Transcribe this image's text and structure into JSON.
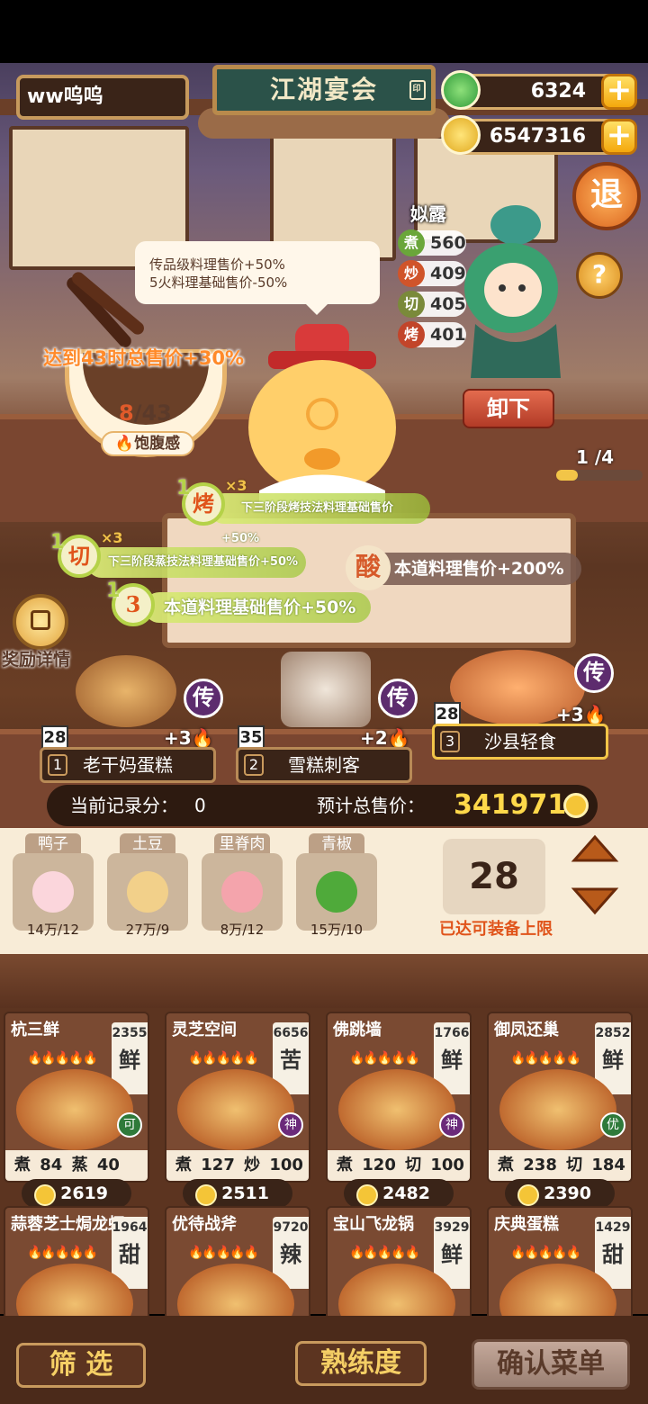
{
  "header": {
    "username": "ww呜呜",
    "title": "江湖宴会",
    "jade": "6324",
    "coins": "6547316",
    "exit_label": "退",
    "help_label": "?"
  },
  "chef": {
    "name": "姒露",
    "stats": [
      {
        "icon": "煮",
        "value": "560",
        "color": "#6aa63a"
      },
      {
        "icon": "炒",
        "value": "409",
        "color": "#d0542a"
      },
      {
        "icon": "切",
        "value": "405",
        "color": "#7a8a3a"
      },
      {
        "icon": "烤",
        "value": "401",
        "color": "#c2452a"
      }
    ],
    "unload_label": "卸下",
    "page": "1 /4",
    "page_fraction": 0.25
  },
  "tooltip": {
    "line1": "传品级料理售价+50%",
    "line2": "5火料理基础售价-50%"
  },
  "satiety": {
    "bonus_text": "达到43时总售价+30%",
    "current": "8",
    "target": "/43",
    "label": "饱腹感"
  },
  "buffs": [
    {
      "num": "1",
      "icon": "烤",
      "mult": "×3",
      "text": "下三阶段烤技法料理基础售价+50%"
    },
    {
      "num": "1",
      "icon": "切",
      "mult": "×3",
      "text": "下三阶段蒸技法料理基础售价+50%"
    },
    {
      "num": "1",
      "icon": "3",
      "text": "本道料理基础售价+50%"
    }
  ],
  "sour_buff": {
    "icon": "酸",
    "text": "本道料理售价+200%"
  },
  "reward_label": "奖励详情",
  "selected_dishes": [
    {
      "index": "1",
      "name": "老干妈蛋糕",
      "level": "28",
      "bonus": "+3",
      "tag": "传"
    },
    {
      "index": "2",
      "name": "雪糕刺客",
      "level": "35",
      "bonus": "+2",
      "tag": "传"
    },
    {
      "index": "3",
      "name": "沙县轻食",
      "level": "28",
      "bonus": "+3",
      "tag": "传"
    }
  ],
  "score": {
    "record_label": "当前记录分：",
    "record_value": "0",
    "total_label": "预计总售价：",
    "total_value": "341971"
  },
  "ingredients": [
    {
      "name": "鸭子",
      "count": "14万/12"
    },
    {
      "name": "土豆",
      "count": "27万/9"
    },
    {
      "name": "里脊肉",
      "count": "8万/12"
    },
    {
      "name": "青椒",
      "count": "15万/10"
    }
  ],
  "capacity": {
    "value": "28",
    "label": "已达可装备上限"
  },
  "recipes": [
    {
      "name": "杭三鲜",
      "price": "2355",
      "taste": "鲜",
      "grade": "可",
      "skills": "煮 84  蒸 40",
      "coins": "2619"
    },
    {
      "name": "灵芝空间",
      "price": "6656",
      "taste": "苦",
      "grade": "神",
      "skills": "煮 127  炒 100",
      "coins": "2511"
    },
    {
      "name": "佛跳墙",
      "price": "1766",
      "taste": "鲜",
      "grade": "神",
      "skills": "煮 120  切 100",
      "coins": "2482"
    },
    {
      "name": "御凤还巢",
      "price": "2852",
      "taste": "鲜",
      "grade": "优",
      "skills": "煮 238  切 184",
      "coins": "2390"
    },
    {
      "name": "蒜蓉芝士焗龙虾",
      "price": "1964",
      "taste": "甜"
    },
    {
      "name": "优待战斧",
      "price": "9720",
      "taste": "辣"
    },
    {
      "name": "宝山飞龙锅",
      "price": "3929",
      "taste": "鲜"
    },
    {
      "name": "庆典蛋糕",
      "price": "1429",
      "taste": "甜"
    }
  ],
  "bottom": {
    "filter_label": "筛 选",
    "proficiency_label": "熟练度",
    "confirm_label": "确认菜单"
  }
}
